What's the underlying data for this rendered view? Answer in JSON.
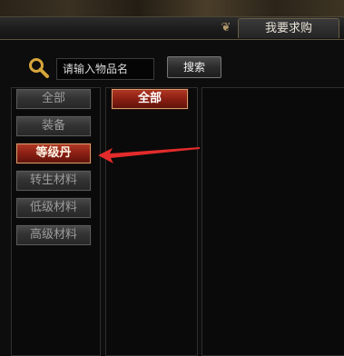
{
  "window": {
    "title": "我要求购"
  },
  "search": {
    "placeholder": "请输入物品名",
    "button_label": "搜索"
  },
  "categories": [
    {
      "label": "全部",
      "active": false
    },
    {
      "label": "装备",
      "active": false
    },
    {
      "label": "等级丹",
      "active": true
    },
    {
      "label": "转生材料",
      "active": false
    },
    {
      "label": "低级材料",
      "active": false
    },
    {
      "label": "高级材料",
      "active": false
    }
  ],
  "subcategory": {
    "label": "全部"
  },
  "colors": {
    "active_red": "#8a1f14",
    "arrow_red": "#e32b2b",
    "search_icon": "#d7a63a",
    "title_text": "#e6e1d6"
  }
}
